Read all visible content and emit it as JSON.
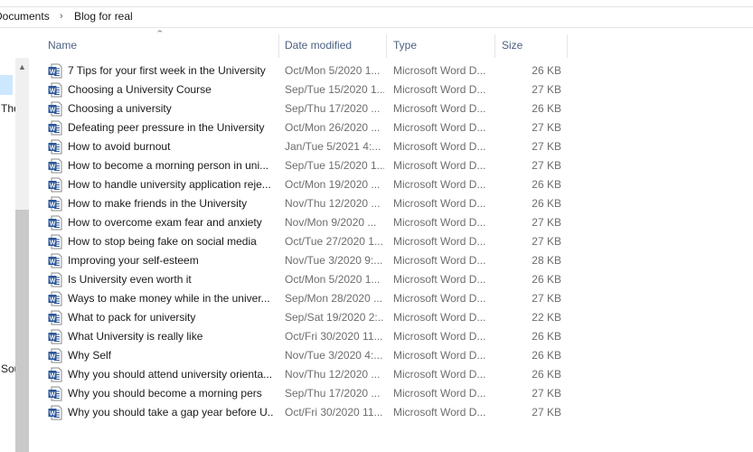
{
  "breadcrumb": {
    "parent": "Documents",
    "current": "Blog for real"
  },
  "navigation_pane": {
    "partial_labels": [
      "The",
      "Sou"
    ]
  },
  "columns": {
    "name": "Name",
    "date": "Date modified",
    "type": "Type",
    "size": "Size"
  },
  "icons": {
    "file": "word-document-icon",
    "separator": "chevron-right-icon",
    "sort": "sort-ascending-icon"
  },
  "colors": {
    "word_blue": "#2b579a",
    "header_text": "#4d6082",
    "selection": "#cce8ff"
  },
  "files": [
    {
      "name": "7 Tips for your first week in the University",
      "date": "Oct/Mon 5/2020 1...",
      "type": "Microsoft Word D...",
      "size": "26 KB"
    },
    {
      "name": "Choosing a University Course",
      "date": "Sep/Tue 15/2020 1...",
      "type": "Microsoft Word D...",
      "size": "27 KB"
    },
    {
      "name": "Choosing a university",
      "date": "Sep/Thu 17/2020 ...",
      "type": "Microsoft Word D...",
      "size": "26 KB"
    },
    {
      "name": "Defeating peer pressure in the University",
      "date": "Oct/Mon 26/2020 ...",
      "type": "Microsoft Word D...",
      "size": "27 KB"
    },
    {
      "name": "How to avoid burnout",
      "date": "Jan/Tue 5/2021 4:...",
      "type": "Microsoft Word D...",
      "size": "27 KB"
    },
    {
      "name": "How to become a morning person in uni...",
      "date": "Sep/Tue 15/2020 1...",
      "type": "Microsoft Word D...",
      "size": "27 KB"
    },
    {
      "name": "How to handle university application reje...",
      "date": "Oct/Mon 19/2020 ...",
      "type": "Microsoft Word D...",
      "size": "26 KB"
    },
    {
      "name": "How to make friends in the University",
      "date": "Nov/Thu 12/2020 ...",
      "type": "Microsoft Word D...",
      "size": "26 KB"
    },
    {
      "name": "How to overcome exam fear and anxiety",
      "date": "Nov/Mon 9/2020 ...",
      "type": "Microsoft Word D...",
      "size": "27 KB"
    },
    {
      "name": "How to stop being fake on social media",
      "date": "Oct/Tue 27/2020 1...",
      "type": "Microsoft Word D...",
      "size": "27 KB"
    },
    {
      "name": "Improving your self-esteem",
      "date": "Nov/Tue 3/2020 9:...",
      "type": "Microsoft Word D...",
      "size": "28 KB"
    },
    {
      "name": "Is University even worth it",
      "date": "Oct/Mon 5/2020 1...",
      "type": "Microsoft Word D...",
      "size": "26 KB"
    },
    {
      "name": "Ways to make money while in the univer...",
      "date": "Sep/Mon 28/2020 ...",
      "type": "Microsoft Word D...",
      "size": "27 KB"
    },
    {
      "name": "What to pack for university",
      "date": "Sep/Sat 19/2020 2:...",
      "type": "Microsoft Word D...",
      "size": "22 KB"
    },
    {
      "name": "What University is really like",
      "date": "Oct/Fri 30/2020 11...",
      "type": "Microsoft Word D...",
      "size": "26 KB"
    },
    {
      "name": "Why Self",
      "date": "Nov/Tue 3/2020 4:...",
      "type": "Microsoft Word D...",
      "size": "26 KB"
    },
    {
      "name": "Why you should attend university orienta...",
      "date": "Nov/Thu 12/2020 ...",
      "type": "Microsoft Word D...",
      "size": "26 KB"
    },
    {
      "name": "Why you should become a morning pers",
      "date": "Sep/Thu 17/2020 ...",
      "type": "Microsoft Word D...",
      "size": "27 KB"
    },
    {
      "name": "Why you should take a gap year before U...",
      "date": "Oct/Fri 30/2020 11...",
      "type": "Microsoft Word D...",
      "size": "27 KB"
    }
  ]
}
